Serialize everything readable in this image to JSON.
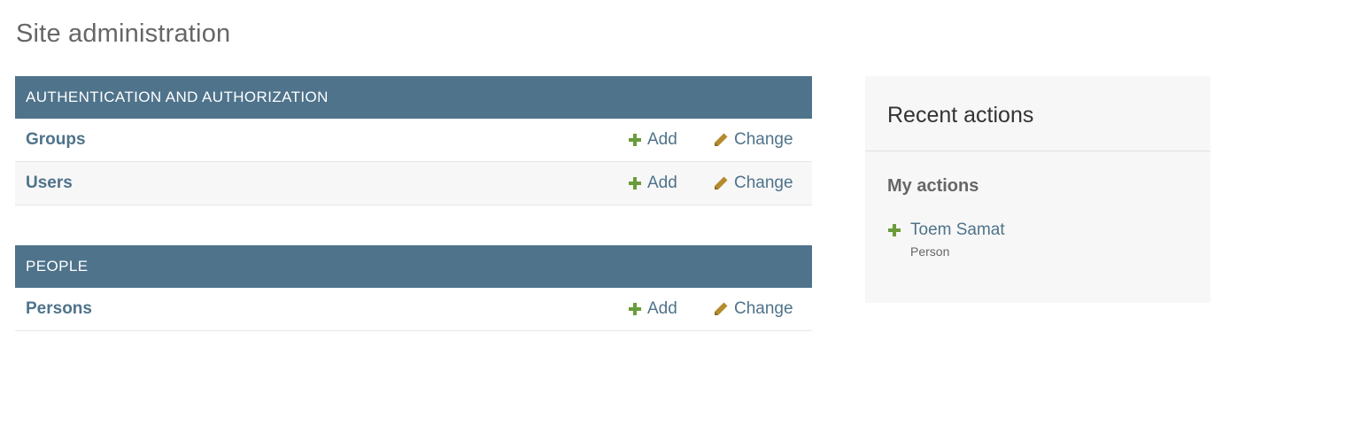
{
  "page": {
    "title": "Site administration"
  },
  "modules": [
    {
      "caption": "AUTHENTICATION AND AUTHORIZATION",
      "models": [
        {
          "name": "Groups",
          "add_label": "Add",
          "change_label": "Change"
        },
        {
          "name": "Users",
          "add_label": "Add",
          "change_label": "Change"
        }
      ]
    },
    {
      "caption": "PEOPLE",
      "models": [
        {
          "name": "Persons",
          "add_label": "Add",
          "change_label": "Change"
        }
      ]
    }
  ],
  "recent_actions": {
    "title": "Recent actions",
    "subtitle": "My actions",
    "items": [
      {
        "name": "Toem Samat",
        "type": "Person",
        "icon": "plus-icon"
      }
    ]
  },
  "colors": {
    "header_bg": "#4f738b",
    "link": "#4f738b",
    "add_icon": "#70bf2b",
    "change_icon": "#efb80b"
  }
}
